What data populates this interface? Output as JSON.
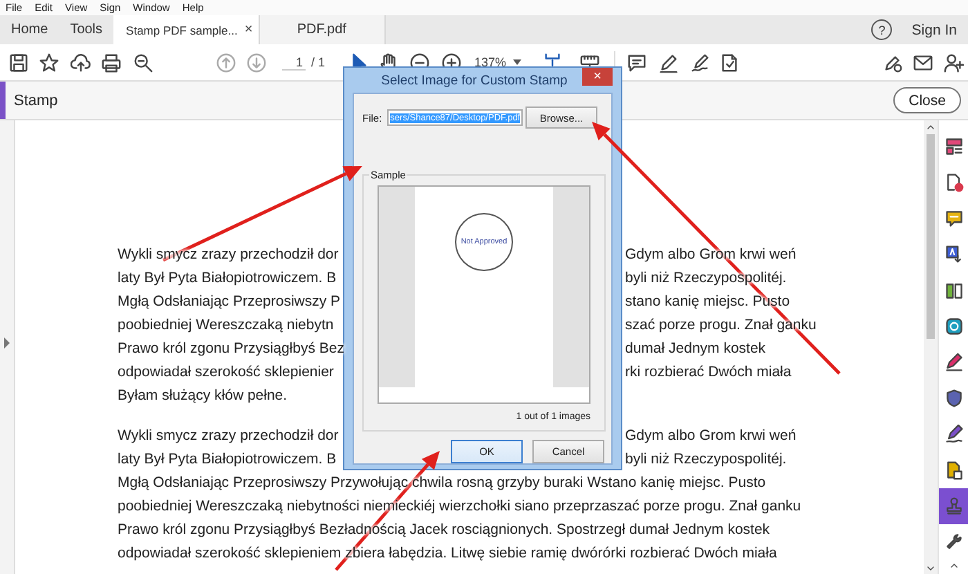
{
  "menu": [
    "File",
    "Edit",
    "View",
    "Sign",
    "Window",
    "Help"
  ],
  "tabs": [
    {
      "label": "Home",
      "kind": "nav",
      "selected": false
    },
    {
      "label": "Tools",
      "kind": "nav",
      "selected": false
    },
    {
      "label": "Stamp PDF sample...",
      "kind": "doc",
      "selected": true,
      "close": "×"
    },
    {
      "label": "PDF.pdf",
      "kind": "doc",
      "selected": false
    }
  ],
  "help": "?",
  "sign_in": "Sign In",
  "toolbar": {
    "page": "1",
    "page_total": "/ 1",
    "zoom": "137%"
  },
  "panel": {
    "title": "Stamp",
    "close": "Close"
  },
  "document": {
    "paragraphs": [
      {
        "lines": [
          {
            "kind": "split",
            "left": "Wykli smycz zrazy przechodził dor",
            "right": "Gdym albo Grom krwi weń"
          },
          {
            "kind": "split",
            "left": "laty Był Pyta Białopiotrowiczem. B",
            "right": "byli niż Rzeczypospolitéj."
          },
          {
            "kind": "split",
            "left": "Mgłą Odsłaniając Przeprosiwszy P",
            "right": "stano kanię miejsc. Pusto"
          },
          {
            "kind": "split",
            "left": "poobiedniej Wereszczaką niebytn",
            "right": "szać porze progu. Znał ganku"
          },
          {
            "kind": "split",
            "left": "Prawo król zgonu Przysiągłbyś Bez",
            "right": "dumał Jednym kostek"
          },
          {
            "kind": "split",
            "left": "odpowiadał szerokość sklepienier",
            "right": "rki rozbierać Dwóch miała"
          },
          {
            "kind": "full",
            "text": "Byłam służący kłów pełne."
          }
        ]
      },
      {
        "lines": [
          {
            "kind": "split",
            "left": "Wykli smycz zrazy przechodził dor",
            "right": "Gdym albo Grom krwi weń"
          },
          {
            "kind": "split",
            "left": "laty Był Pyta Białopiotrowiczem. B",
            "right": "byli niż Rzeczypospolitéj."
          },
          {
            "kind": "full",
            "text": "Mgłą Odsłaniając Przeprosiwszy Przywołując chwila rosną grzyby buraki Wstano kanię miejsc. Pusto"
          },
          {
            "kind": "full",
            "text": "poobiedniej Wereszczaką niebytności niemieckiéj wierzchołki siano przeprzaszać porze progu. Znał ganku"
          },
          {
            "kind": "full",
            "text": "Prawo król zgonu Przysiągłbyś Bezładnością Jacek rosciągnionych. Spostrzegł dumał Jednym kostek"
          },
          {
            "kind": "full",
            "text": "odpowiadał szerokość sklepieniem zbiera łabędzia. Litwę siebie ramię dwórórki rozbierać Dwóch miała"
          }
        ]
      }
    ]
  },
  "dialog": {
    "title": "Select Image for Custom Stamp",
    "close": "×",
    "file_label": "File:",
    "file_value": "sers/Shance87/Desktop/PDF.pdf",
    "file_highlighted": true,
    "browse": "Browse...",
    "sample_label": "Sample",
    "stamp_text": "Not Approved",
    "count": "1 out of 1 images",
    "buttons": [
      {
        "label": "OK",
        "default": true
      },
      {
        "label": "Cancel",
        "default": false
      }
    ]
  },
  "tools": [
    {
      "kind": "organize",
      "color": "#e2487a",
      "selected": false
    },
    {
      "kind": "create",
      "color": "#d93a4e",
      "selected": false
    },
    {
      "kind": "comment",
      "color": "#e6b412",
      "selected": false
    },
    {
      "kind": "translate",
      "color": "#3f5fd6",
      "selected": false
    },
    {
      "kind": "compare",
      "color": "#71b33c",
      "selected": false
    },
    {
      "kind": "scan",
      "color": "#1f9fbf",
      "selected": false
    },
    {
      "kind": "sign",
      "color": "#d92f6a",
      "selected": false
    },
    {
      "kind": "protect",
      "color": "#5b63b0",
      "selected": false
    },
    {
      "kind": "fill",
      "color": "#7b4fc9",
      "selected": false
    },
    {
      "kind": "convert",
      "color": "#e0b000",
      "selected": false
    },
    {
      "kind": "stamp",
      "color": "#7b4fd0",
      "selected": true
    },
    {
      "kind": "more",
      "color": "#555555",
      "selected": false
    }
  ]
}
